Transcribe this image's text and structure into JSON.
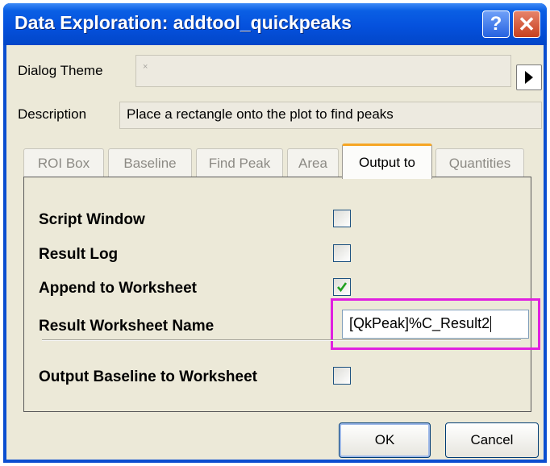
{
  "window": {
    "title": "Data Exploration: addtool_quickpeaks"
  },
  "titlebar": {
    "help_glyph": "?",
    "close_glyph": "✕"
  },
  "dialog_theme": {
    "label": "Dialog Theme",
    "value_glyph": "×",
    "arrow_icon": "triangle-right-icon"
  },
  "description": {
    "label": "Description",
    "text": "Place a rectangle onto the plot to find peaks"
  },
  "tabs": [
    {
      "label": "ROI Box",
      "active": false
    },
    {
      "label": "Baseline",
      "active": false
    },
    {
      "label": "Find Peak",
      "active": false
    },
    {
      "label": "Area",
      "active": false
    },
    {
      "label": "Output to",
      "active": true
    },
    {
      "label": "Quantities",
      "active": false
    }
  ],
  "output": {
    "script_window": {
      "label": "Script Window",
      "checked": false
    },
    "result_log": {
      "label": "Result Log",
      "checked": false
    },
    "append_worksheet": {
      "label": "Append to Worksheet",
      "checked": true
    },
    "result_sheet_name": {
      "label": "Result Worksheet Name",
      "value": "[QkPeak]%C_Result2"
    },
    "output_baseline": {
      "label": "Output Baseline to Worksheet",
      "checked": false
    }
  },
  "buttons": {
    "ok": "OK",
    "cancel": "Cancel"
  },
  "colors": {
    "titlebar": "#0551DD",
    "highlight": "#E020E0",
    "active_tab_accent": "#F6A624",
    "checkmark": "#21A121"
  }
}
